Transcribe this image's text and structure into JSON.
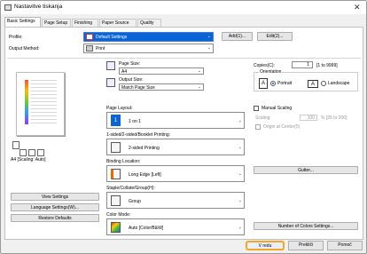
{
  "window": {
    "title": "Nastavitve tiskanja"
  },
  "tabs": [
    "Basic Settings",
    "Page Setup",
    "Finishing",
    "Paper Source",
    "Quality"
  ],
  "profile": {
    "label": "Profile:",
    "value": "Default Settings",
    "add_label": "Add(1)...",
    "edit_label": "Edit(2)..."
  },
  "output": {
    "label": "Output Method:",
    "value": "Print"
  },
  "preview": {
    "caption": "A4 [Scaling: Auto]"
  },
  "left_buttons": {
    "view": "View Settings",
    "language": "Language Settings(W)...",
    "restore": "Restore Defaults"
  },
  "page_size": {
    "label": "Page Size:",
    "value": "A4"
  },
  "output_size": {
    "label": "Output Size:",
    "value": "Match Page Size"
  },
  "copies": {
    "label": "Copies(C):",
    "value": "1",
    "range": "[1 to 9999]"
  },
  "orientation": {
    "label": "Orientation",
    "portrait": "Portrait",
    "landscape": "Landscape"
  },
  "layout": {
    "label": "Page Layout:",
    "value": "1 on 1"
  },
  "manual_scaling": {
    "label": "Manual Scaling",
    "scaling_label": "Scaling:",
    "scaling_value": "100",
    "scaling_range": "% [25 to 200]",
    "origin": "Origin at Center(5)"
  },
  "duplex": {
    "label": "1-sided/2-sided/Booklet Printing:",
    "value": "2-sided Printing"
  },
  "binding": {
    "label": "Binding Location:",
    "value": "Long Edge [Left]",
    "gutter": "Gutter..."
  },
  "staple": {
    "label": "Staple/Collate/Group(H):",
    "value": "Group"
  },
  "color": {
    "label": "Color Mode:",
    "value": "Auto [Color/B&W]",
    "num_colors": "Number of Colors Settings..."
  },
  "footer": {
    "ok": "V redu",
    "cancel": "Prekliči",
    "help": "Pomoč"
  }
}
